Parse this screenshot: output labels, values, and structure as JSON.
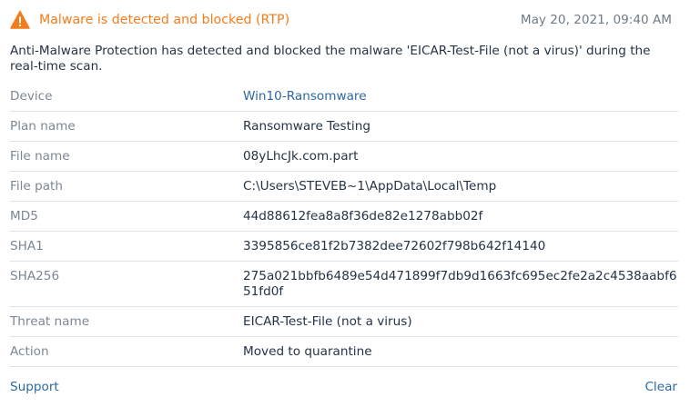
{
  "alert": {
    "title": "Malware is detected and blocked (RTP)",
    "timestamp": "May 20, 2021, 09:40 AM",
    "icon": "warning-triangle-icon",
    "accent_color": "#f37d1c",
    "description": "Anti-Malware Protection has detected and blocked the malware 'EICAR-Test-File (not a virus)' during the real-time scan."
  },
  "details": [
    {
      "label": "Device",
      "value": "Win10-Ransomware"
    },
    {
      "label": "Plan name",
      "value": "Ransomware Testing"
    },
    {
      "label": "File name",
      "value": "08yLhcJk.com.part"
    },
    {
      "label": "File path",
      "value": "C:\\Users\\STEVEB~1\\AppData\\Local\\Temp"
    },
    {
      "label": "MD5",
      "value": "44d88612fea8a8f36de82e1278abb02f"
    },
    {
      "label": "SHA1",
      "value": "3395856ce81f2b7382dee72602f798b642f14140"
    },
    {
      "label": "SHA256",
      "value": "275a021bbfb6489e54d471899f7db9d1663fc695ec2fe2a2c4538aabf651fd0f"
    },
    {
      "label": "Threat name",
      "value": "EICAR-Test-File (not a virus)"
    },
    {
      "label": "Action",
      "value": "Moved to quarantine"
    }
  ],
  "footer": {
    "support_label": "Support",
    "clear_label": "Clear"
  }
}
